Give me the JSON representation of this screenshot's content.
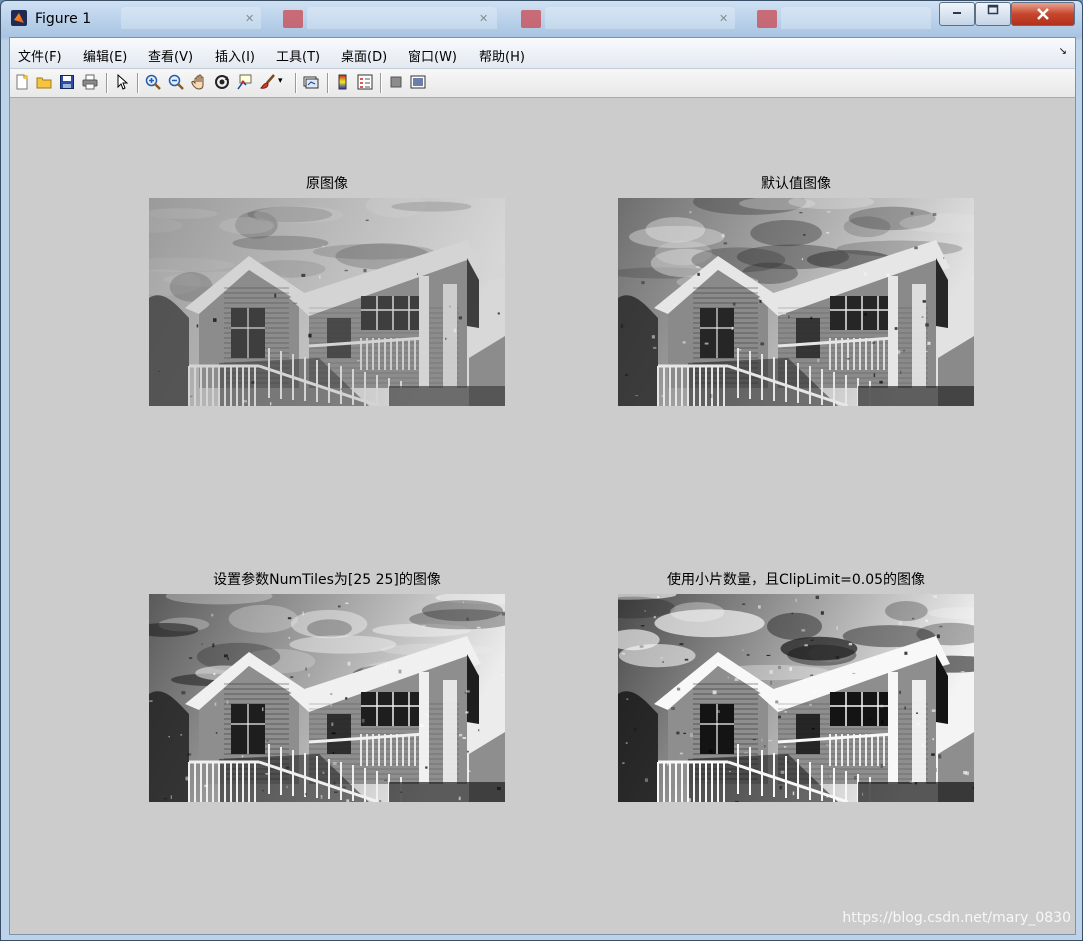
{
  "window": {
    "title": "Figure 1"
  },
  "menu": [
    "文件(F)",
    "编辑(E)",
    "查看(V)",
    "插入(I)",
    "工具(T)",
    "桌面(D)",
    "窗口(W)",
    "帮助(H)"
  ],
  "menu_overflow_icon": "chevron-icon",
  "toolbar": {
    "tools": [
      "new-figure-icon",
      "open-icon",
      "save-icon",
      "print-icon",
      "pointer-icon",
      "zoom-in-icon",
      "zoom-out-icon",
      "pan-icon",
      "rotate-icon",
      "data-cursor-icon",
      "brush-icon",
      "link-icon",
      "colorbar-icon",
      "legend-icon",
      "hide-plot-tools-icon",
      "show-plot-tools-icon"
    ]
  },
  "axes": [
    {
      "title": "原图像",
      "variant": "original"
    },
    {
      "title": "默认值图像",
      "variant": "default"
    },
    {
      "title": "设置参数NumTiles为[25 25]的图像",
      "variant": "numtiles"
    },
    {
      "title": "使用小片数量，且ClipLimit=0.05的图像",
      "variant": "cliplimit"
    }
  ],
  "watermark": "https://blog.csdn.net/mary_0830",
  "colors": {
    "figure_bg": "#cccccc",
    "close_button": "#c7462d"
  }
}
